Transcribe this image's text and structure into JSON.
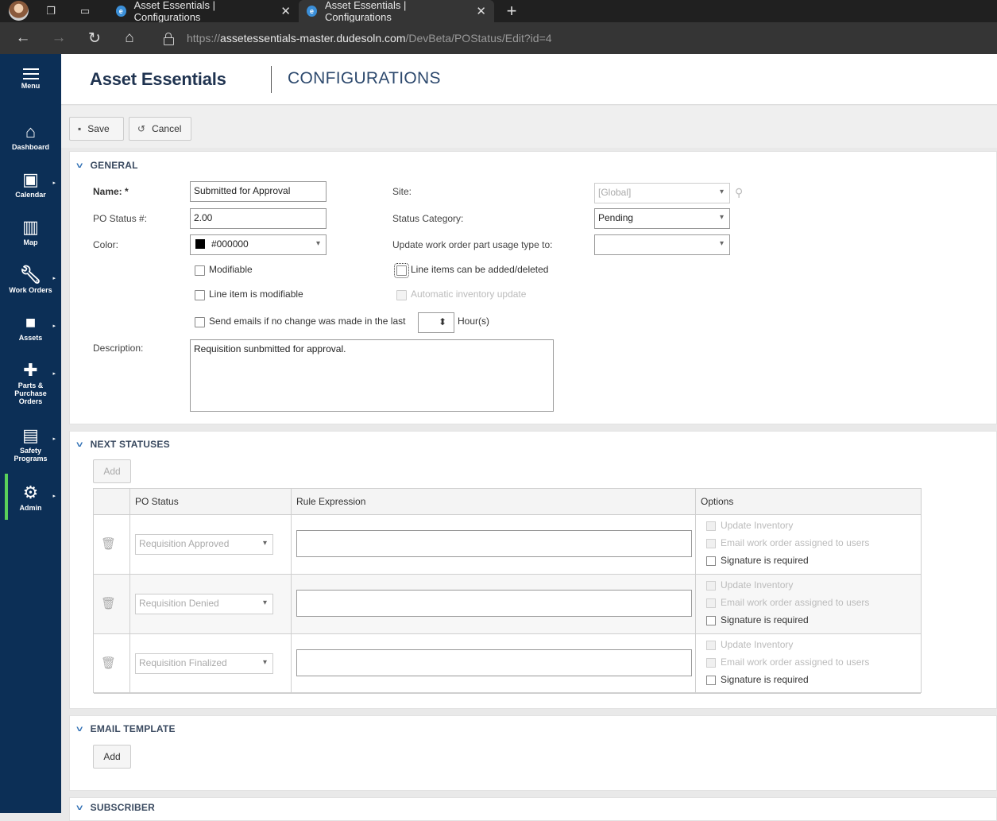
{
  "browser": {
    "tabs": [
      {
        "title": "Asset Essentials | Configurations",
        "active": false
      },
      {
        "title": "Asset Essentials | Configurations",
        "active": true
      }
    ],
    "url_scheme": "https://",
    "url_host": "assetessentials-master.dudesoln.com",
    "url_path": "/DevBeta/POStatus/Edit?id=4"
  },
  "sidebar": {
    "items": [
      {
        "label": "Menu",
        "icon": "hamburger-icon"
      },
      {
        "label": "Dashboard",
        "icon": "home-icon"
      },
      {
        "label": "Calendar",
        "icon": "calendar-icon"
      },
      {
        "label": "Map",
        "icon": "map-icon"
      },
      {
        "label": "Work Orders",
        "icon": "wrench-icon"
      },
      {
        "label": "Assets",
        "icon": "briefcase-icon"
      },
      {
        "label": "Parts & Purchase Orders",
        "icon": "puzzle-icon"
      },
      {
        "label": "Safety Programs",
        "icon": "clipboard-icon"
      },
      {
        "label": "Admin",
        "icon": "gear-icon"
      }
    ],
    "active_color": "#5ad15a",
    "bg_color": "#0c2f56"
  },
  "header": {
    "brand": "Asset Essentials",
    "title": "CONFIGURATIONS"
  },
  "toolbar": {
    "save_label": "Save",
    "cancel_label": "Cancel"
  },
  "general": {
    "section_title": "GENERAL",
    "name_label": "Name: *",
    "name_value": "Submitted for Approval",
    "po_status_label": "PO Status #:",
    "po_status_value": "2.00",
    "color_label": "Color:",
    "color_value": "#000000",
    "site_label": "Site:",
    "site_value": "[Global]",
    "status_category_label": "Status Category:",
    "status_category_value": "Pending",
    "update_wo_label": "Update work order part usage type to:",
    "update_wo_value": "",
    "modifiable_label": "Modifiable",
    "line_item_modifiable_label": "Line item is modifiable",
    "send_emails_label": "Send emails if no change was made in the last",
    "hours_label": "Hour(s)",
    "line_items_added_label": "Line items can be added/deleted",
    "auto_inventory_label": "Automatic inventory update",
    "description_label": "Description:",
    "description_value": "Requisition sunbmitted for approval."
  },
  "next_statuses": {
    "section_title": "NEXT STATUSES",
    "add_label": "Add",
    "columns": [
      "PO Status",
      "Rule Expression",
      "Options"
    ],
    "rows": [
      {
        "po_status": "Requisition Approved",
        "rule": "",
        "options": [
          "Update Inventory",
          "Email work order assigned to users",
          "Signature is required"
        ]
      },
      {
        "po_status": "Requisition Denied",
        "rule": "",
        "options": [
          "Update Inventory",
          "Email work order assigned to users",
          "Signature is required"
        ]
      },
      {
        "po_status": "Requisition Finalized",
        "rule": "",
        "options": [
          "Update Inventory",
          "Email work order assigned to users",
          "Signature is required"
        ]
      }
    ]
  },
  "email_template": {
    "section_title": "EMAIL TEMPLATE",
    "add_label": "Add"
  },
  "subscriber": {
    "section_title": "SUBSCRIBER"
  }
}
